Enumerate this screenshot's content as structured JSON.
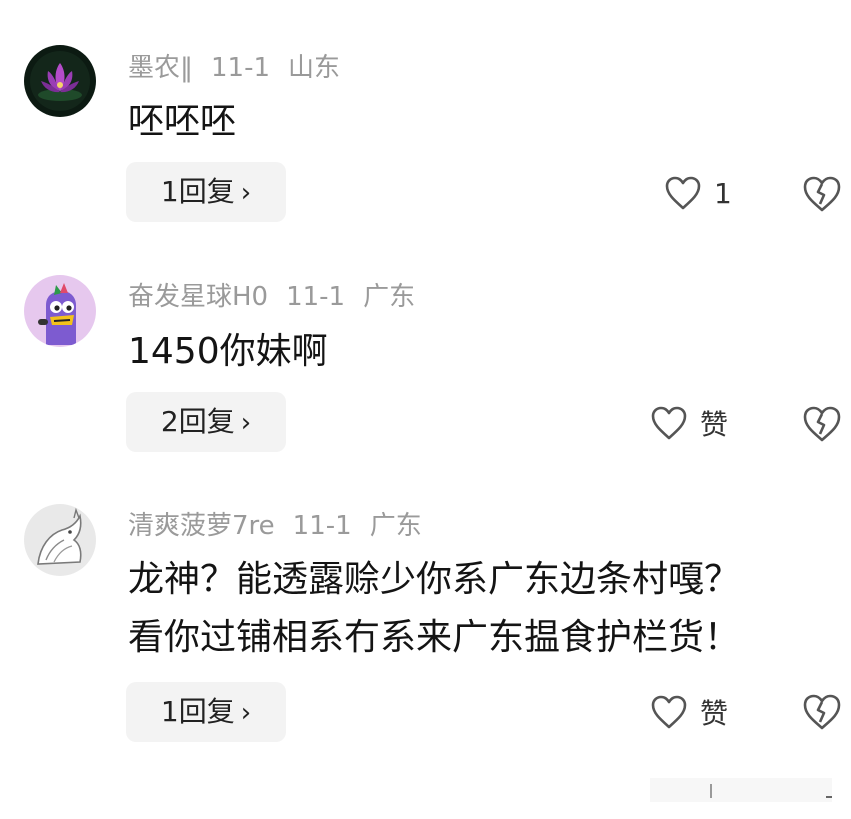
{
  "comments": [
    {
      "username": "墨农‖",
      "date": "11-1",
      "location": "山东",
      "text": [
        "呸呸呸"
      ],
      "reply_label": "1回复",
      "like_label": "1",
      "avatar": "lotus-avatar-icon"
    },
    {
      "username": "奋发星球H0",
      "date": "11-1",
      "location": "广东",
      "text": [
        "1450你妹啊"
      ],
      "reply_label": "2回复",
      "like_label": "赞",
      "avatar": "cartoon-character-avatar-icon"
    },
    {
      "username": "清爽菠萝7re",
      "date": "11-1",
      "location": "广东",
      "text": [
        "龙神？能透露赊少你系广东边条村嘎？",
        "看你过铺相系冇系来广东揾食护栏货！"
      ],
      "reply_label": "1回复",
      "like_label": "赞",
      "avatar": "sketch-animal-avatar-icon"
    }
  ],
  "icons": {
    "reply_chevron": "chevron-right-icon",
    "like": "heart-outline-icon",
    "dislike": "broken-heart-icon"
  },
  "colors": {
    "meta_text": "#9a9a9a",
    "reply_button_bg": "#f3f3f3",
    "text": "#141414"
  }
}
